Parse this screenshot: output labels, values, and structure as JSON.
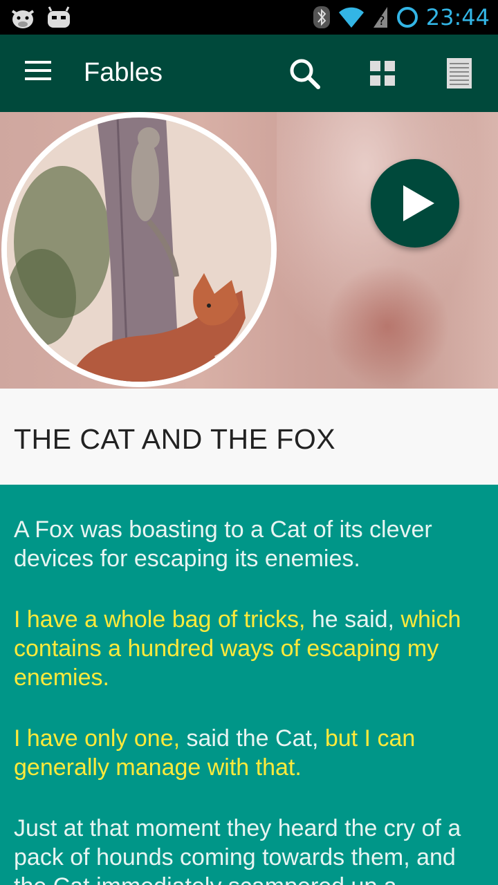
{
  "status_bar": {
    "time": "23:44",
    "icons": [
      "cyanogen-cow-icon",
      "android-bot-icon",
      "bluetooth-icon",
      "wifi-icon",
      "no-signal-icon",
      "battery-ring-icon"
    ]
  },
  "app_bar": {
    "title": "Fables",
    "actions": [
      "search-icon",
      "grid-view-icon",
      "list-view-icon"
    ]
  },
  "header": {
    "image_alt": "Cat on tree and fox",
    "play_icon": "play-icon"
  },
  "story": {
    "title": "THE CAT AND THE FOX",
    "paragraphs": [
      [
        {
          "text": "A Fox was boasting to a Cat of its clever devices for escaping its enemies.",
          "quote": false
        }
      ],
      [
        {
          "text": "I have a whole bag of tricks,",
          "quote": true
        },
        {
          "text": " he said, ",
          "quote": false
        },
        {
          "text": "which contains a hundred ways of escaping my enemies.",
          "quote": true
        }
      ],
      [
        {
          "text": "I have only one,",
          "quote": true
        },
        {
          "text": " said the Cat, ",
          "quote": false
        },
        {
          "text": "but I can generally manage with that.",
          "quote": true
        }
      ],
      [
        {
          "text": "Just at that moment they heard the cry of a pack of hounds coming towards them, and the Cat immediately scampered up a",
          "quote": false
        }
      ]
    ]
  },
  "colors": {
    "app_bar": "#00493b",
    "body_bg": "#009688",
    "quote_text": "#ffea3b",
    "body_text": "#e8f5f2",
    "status_accent": "#33b5e5"
  }
}
